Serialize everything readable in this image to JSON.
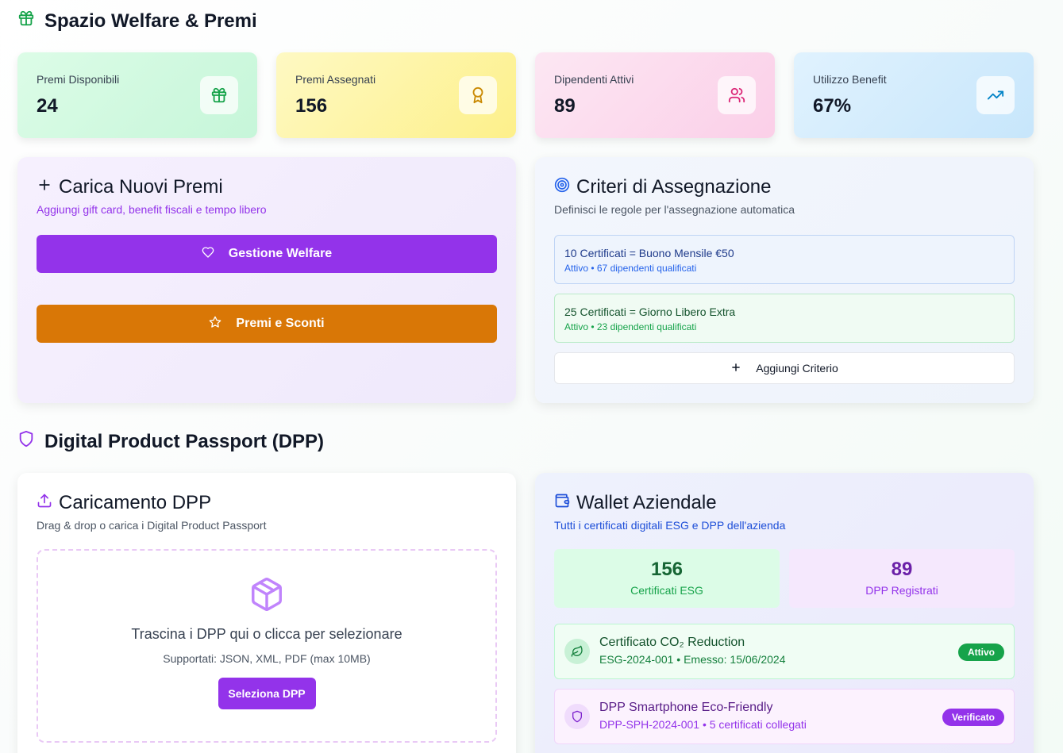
{
  "welfare": {
    "title": "Spazio Welfare & Premi",
    "stats": [
      {
        "label": "Premi Disponibili",
        "value": "24",
        "icon": "gift-icon"
      },
      {
        "label": "Premi Assegnati",
        "value": "156",
        "icon": "award-icon"
      },
      {
        "label": "Dipendenti Attivi",
        "value": "89",
        "icon": "users-icon"
      },
      {
        "label": "Utilizzo Benefit",
        "value": "67%",
        "icon": "trending-up-icon"
      }
    ],
    "upload_card": {
      "title": "Carica Nuovi Premi",
      "subtitle": "Aggiungi gift card, benefit fiscali e tempo libero",
      "btn_welfare": "Gestione Welfare",
      "btn_premi": "Premi e Sconti"
    },
    "criteria_card": {
      "title": "Criteri di Assegnazione",
      "subtitle": "Definisci le regole per l'assegnazione automatica",
      "criteria": [
        {
          "title": "10 Certificati = Buono Mensile €50",
          "status": "Attivo • 67 dipendenti qualificati"
        },
        {
          "title": "25 Certificati = Giorno Libero Extra",
          "status": "Attivo • 23 dipendenti qualificati"
        }
      ],
      "add_label": "Aggiungi Criterio"
    }
  },
  "dpp": {
    "title": "Digital Product Passport (DPP)",
    "upload_card": {
      "title": "Caricamento DPP",
      "subtitle": "Drag & drop o carica i Digital Product Passport",
      "drop_text": "Trascina i DPP qui o clicca per selezionare",
      "supported": "Supportati: JSON, XML, PDF (max 10MB)",
      "select_btn": "Seleziona DPP"
    },
    "wallet_card": {
      "title": "Wallet Aziendale",
      "subtitle": "Tutti i certificati digitali ESG e DPP dell'azienda",
      "stats": [
        {
          "value": "156",
          "label": "Certificati ESG"
        },
        {
          "value": "89",
          "label": "DPP Registrati"
        }
      ],
      "items": [
        {
          "title": "Certificato CO₂ Reduction",
          "meta": "ESG-2024-001 • Emesso: 15/06/2024",
          "badge": "Attivo",
          "icon": "leaf-icon"
        },
        {
          "title": "DPP Smartphone Eco-Friendly",
          "meta": "DPP-SPH-2024-001 • 5 certificati collegati",
          "badge": "Verificato",
          "icon": "shield-icon"
        }
      ]
    }
  }
}
